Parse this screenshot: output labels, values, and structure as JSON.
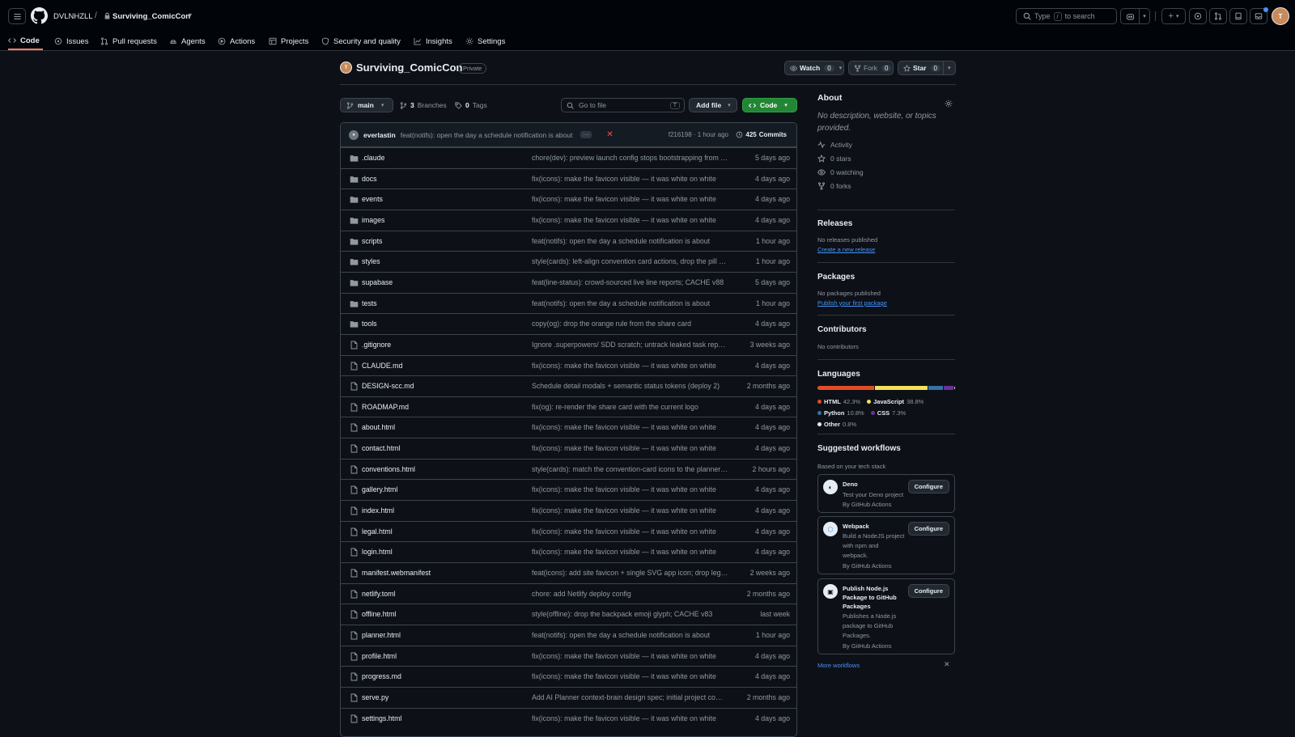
{
  "header": {
    "owner": "DVLNHZLL",
    "repo": "Surviving_ComicCon",
    "search_placeholder_pre": "Type",
    "search_key": "/",
    "search_placeholder_post": "to search"
  },
  "tabs": [
    {
      "label": "Code",
      "icon": "code-icon"
    },
    {
      "label": "Issues",
      "icon": "issue-icon"
    },
    {
      "label": "Pull requests",
      "icon": "pull-request-icon"
    },
    {
      "label": "Agents",
      "icon": "agent-icon"
    },
    {
      "label": "Actions",
      "icon": "play-icon"
    },
    {
      "label": "Projects",
      "icon": "table-icon"
    },
    {
      "label": "Security and quality",
      "icon": "shield-icon"
    },
    {
      "label": "Insights",
      "icon": "graph-icon"
    },
    {
      "label": "Settings",
      "icon": "gear-icon"
    }
  ],
  "repo": {
    "name": "Surviving_ComicCon",
    "visibility": "Private",
    "watch_label": "Watch",
    "watch_count": "0",
    "fork_label": "Fork",
    "fork_count": "0",
    "star_label": "Star",
    "star_count": "0"
  },
  "toolbar": {
    "branch": "main",
    "branches_count": "3",
    "branches_label": "Branches",
    "tags_count": "0",
    "tags_label": "Tags",
    "goto_placeholder": "Go to file",
    "goto_key": "T",
    "add_file": "Add file",
    "code": "Code"
  },
  "commit": {
    "author": "everlastin",
    "message": "feat(notifs): open the day a schedule notification is about",
    "hash_time": "f216198 · 1 hour ago",
    "commits_count": "425",
    "commits_label": "Commits"
  },
  "files": [
    {
      "type": "dir",
      "name": ".claude",
      "message": "chore(dev): preview launch config stops bootstrapping from the monorepo",
      "age": "5 days ago"
    },
    {
      "type": "dir",
      "name": "docs",
      "message": "fix(icons): make the favicon visible — it was white on white",
      "age": "4 days ago"
    },
    {
      "type": "dir",
      "name": "events",
      "message": "fix(icons): make the favicon visible — it was white on white",
      "age": "4 days ago"
    },
    {
      "type": "dir",
      "name": "images",
      "message": "fix(icons): make the favicon visible — it was white on white",
      "age": "4 days ago"
    },
    {
      "type": "dir",
      "name": "scripts",
      "message": "feat(notifs): open the day a schedule notification is about",
      "age": "1 hour ago"
    },
    {
      "type": "dir",
      "name": "styles",
      "message": "style(cards): left-align convention card actions, drop the pill buttons",
      "age": "1 hour ago"
    },
    {
      "type": "dir",
      "name": "supabase",
      "message": "feat(line-status): crowd-sourced live line reports; CACHE v88",
      "age": "5 days ago"
    },
    {
      "type": "dir",
      "name": "tests",
      "message": "feat(notifs): open the day a schedule notification is about",
      "age": "1 hour ago"
    },
    {
      "type": "dir",
      "name": "tools",
      "message": "copy(og): drop the orange rule from the share card",
      "age": "4 days ago"
    },
    {
      "type": "file",
      "name": ".gitignore",
      "message": "Ignore .superpowers/ SDD scratch; untrack leaked task reports",
      "age": "3 weeks ago"
    },
    {
      "type": "file",
      "name": "CLAUDE.md",
      "message": "fix(icons): make the favicon visible — it was white on white",
      "age": "4 days ago"
    },
    {
      "type": "file",
      "name": "DESIGN-scc.md",
      "message": "Schedule detail modals + semantic status tokens (deploy 2)",
      "age": "2 months ago"
    },
    {
      "type": "file",
      "name": "ROADMAP.md",
      "message": "fix(og): re-render the share card with the current logo",
      "age": "4 days ago"
    },
    {
      "type": "file",
      "name": "about.html",
      "message": "fix(icons): make the favicon visible — it was white on white",
      "age": "4 days ago"
    },
    {
      "type": "file",
      "name": "contact.html",
      "message": "fix(icons): make the favicon visible — it was white on white",
      "age": "4 days ago"
    },
    {
      "type": "file",
      "name": "conventions.html",
      "message": "style(cards): match the convention-card icons to the planner cards",
      "age": "2 hours ago"
    },
    {
      "type": "file",
      "name": "gallery.html",
      "message": "fix(icons): make the favicon visible — it was white on white",
      "age": "4 days ago"
    },
    {
      "type": "file",
      "name": "index.html",
      "message": "fix(icons): make the favicon visible — it was white on white",
      "age": "4 days ago"
    },
    {
      "type": "file",
      "name": "legal.html",
      "message": "fix(icons): make the favicon visible — it was white on white",
      "age": "4 days ago"
    },
    {
      "type": "file",
      "name": "login.html",
      "message": "fix(icons): make the favicon visible — it was white on white",
      "age": "4 days ago"
    },
    {
      "type": "file",
      "name": "manifest.webmanifest",
      "message": "feat(icons): add site favicon + single SVG app icon; drop legacy PNGs",
      "age": "2 weeks ago"
    },
    {
      "type": "file",
      "name": "netlify.toml",
      "message": "chore: add Netlify deploy config",
      "age": "2 months ago"
    },
    {
      "type": "file",
      "name": "offline.html",
      "message": "style(offline): drop the backpack emoji glyph; CACHE v83",
      "age": "last week"
    },
    {
      "type": "file",
      "name": "planner.html",
      "message": "feat(notifs): open the day a schedule notification is about",
      "age": "1 hour ago"
    },
    {
      "type": "file",
      "name": "profile.html",
      "message": "fix(icons): make the favicon visible — it was white on white",
      "age": "4 days ago"
    },
    {
      "type": "file",
      "name": "progress.md",
      "message": "fix(icons): make the favicon visible — it was white on white",
      "age": "4 days ago"
    },
    {
      "type": "file",
      "name": "serve.py",
      "message": "Add AI Planner context-brain design spec; initial project commit",
      "age": "2 months ago"
    },
    {
      "type": "file",
      "name": "settings.html",
      "message": "fix(icons): make the favicon visible — it was white on white",
      "age": "4 days ago"
    }
  ],
  "about": {
    "title": "About",
    "description": "No description, website, or topics provided.",
    "activity": "Activity",
    "stars": "0 stars",
    "watching": "0 watching",
    "forks": "0 forks"
  },
  "releases": {
    "title": "Releases",
    "none": "No releases published",
    "link": "Create a new release"
  },
  "packages": {
    "title": "Packages",
    "none": "No packages published",
    "link": "Publish your first package"
  },
  "contributors": {
    "title": "Contributors",
    "none": "No contributors"
  },
  "languages": {
    "title": "Languages",
    "items": [
      {
        "name": "HTML",
        "percent": "42.3%",
        "value": 42.3,
        "color": "#e34c26"
      },
      {
        "name": "JavaScript",
        "percent": "38.8%",
        "value": 38.8,
        "color": "#f1e05a"
      },
      {
        "name": "Python",
        "percent": "10.8%",
        "value": 10.8,
        "color": "#3572A5"
      },
      {
        "name": "CSS",
        "percent": "7.3%",
        "value": 7.3,
        "color": "#663399"
      },
      {
        "name": "Other",
        "percent": "0.8%",
        "value": 0.8,
        "color": "#ededed"
      }
    ]
  },
  "workflows": {
    "title": "Suggested workflows",
    "subtitle": "Based on your tech stack",
    "configure": "Configure",
    "items": [
      {
        "name": "Deno",
        "lines": [
          "Test your Deno project"
        ],
        "by": "By GitHub Actions"
      },
      {
        "name": "Webpack",
        "lines": [
          "Build a NodeJS project",
          "with npm and",
          "webpack."
        ],
        "by": "By GitHub Actions"
      },
      {
        "name": "Publish Node.js Package to GitHub Packages",
        "lines": [
          "Publishes a Node.js",
          "package to GitHub",
          "Packages."
        ],
        "by": "By GitHub Actions"
      }
    ],
    "more": "More workflows"
  }
}
